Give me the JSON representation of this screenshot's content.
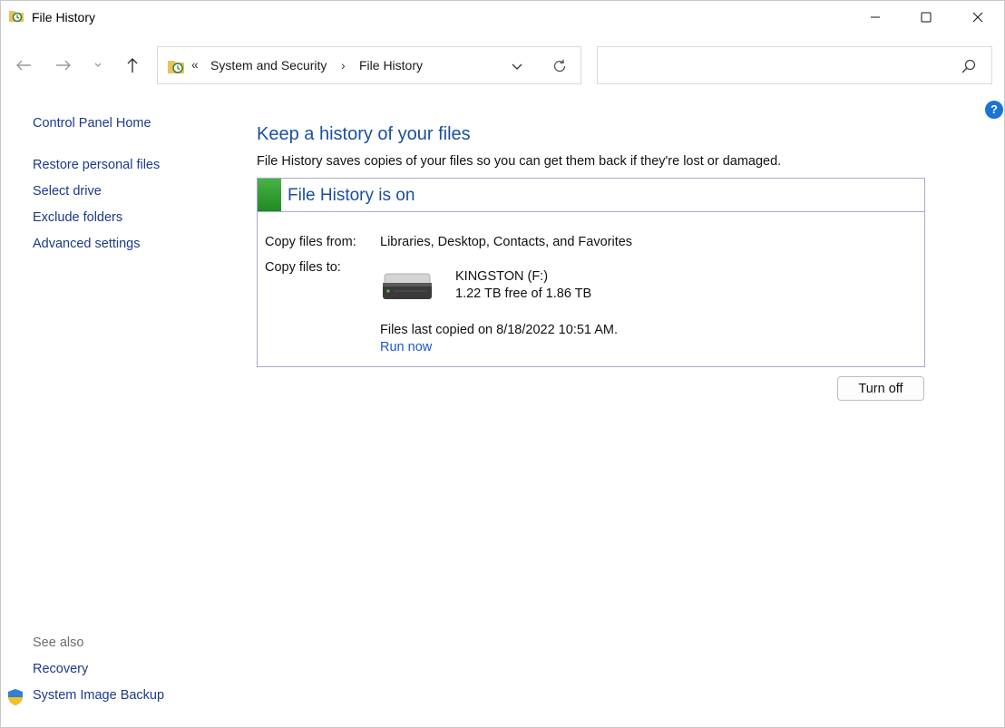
{
  "window": {
    "title": "File History",
    "app_icon": "file-history-icon",
    "controls": [
      "minimize-icon",
      "maximize-icon",
      "close-icon"
    ]
  },
  "navigation": {
    "back_icon": "back-arrow-icon",
    "forward_icon": "forward-arrow-icon",
    "recent_icon": "chevron-down-icon",
    "up_icon": "up-arrow-icon"
  },
  "address_bar": {
    "overflow_chevron": "«",
    "segments": [
      "System and Security",
      "File History"
    ],
    "separator": "›"
  },
  "search": {
    "placeholder": "",
    "value": ""
  },
  "sidebar": {
    "home": "Control Panel Home",
    "links": [
      "Restore personal files",
      "Select drive",
      "Exclude folders",
      "Advanced settings"
    ],
    "see_also_label": "See also",
    "see_also": [
      "Recovery",
      "System Image Backup"
    ]
  },
  "main": {
    "title": "Keep a history of your files",
    "description": "File History saves copies of your files so you can get them back if they're lost or damaged.",
    "status": {
      "title": "File History is on",
      "color": "#2e9b2e"
    },
    "copy_from_label": "Copy files from:",
    "copy_from_value": "Libraries, Desktop, Contacts, and Favorites",
    "copy_to_label": "Copy files to:",
    "drive": {
      "name": "KINGSTON (F:)",
      "free": "1.22 TB free of 1.86 TB"
    },
    "last_copied": "Files last copied on 8/18/2022 10:51 AM.",
    "run_now": "Run now",
    "turn_off": "Turn off"
  },
  "colors": {
    "link": "#1b3a8a",
    "heading": "#1a4fa0",
    "help": "#1a73d9"
  }
}
